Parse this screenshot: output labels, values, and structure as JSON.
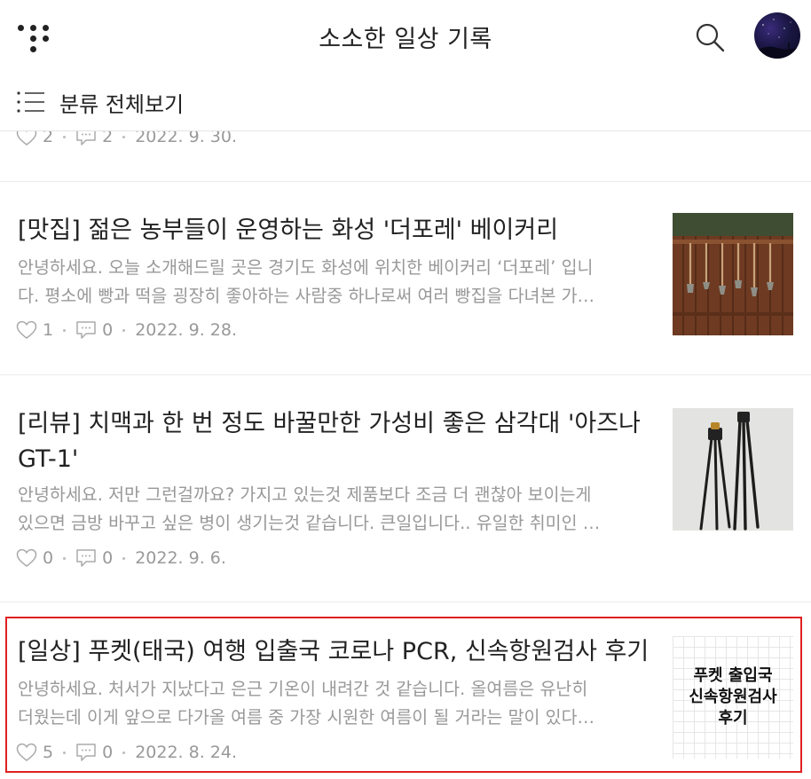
{
  "header": {
    "site_title": "소소한 일상 기록",
    "icons": [
      "menu-dots-icon",
      "search-icon",
      "avatar"
    ]
  },
  "category_bar": {
    "label": "분류 전체보기"
  },
  "partial_post": {
    "likes": "2",
    "comments": "2",
    "date": "2022. 9. 30."
  },
  "posts": [
    {
      "title": "[맛집] 젊은 농부들이 운영하는 화성 '더포레' 베이커리",
      "summary_line1": "안녕하세요. 오늘 소개해드릴 곳은 경기도 화성에 위치한 베이커리 ‘더포레’ 입니",
      "summary_line2": "다. 평소에 빵과 떡을 굉장히 좋아하는 사람중 하나로써 여러 빵집을 다녀본 가…",
      "likes": "1",
      "comments": "0",
      "date": "2022. 9. 28."
    },
    {
      "title": "[리뷰] 치맥과 한 번 정도 바꿀만한 가성비 좋은 삼각대 '아즈나 GT-1'",
      "summary_line1": "안녕하세요. 저만 그런걸까요? 가지고 있는것 제품보다 조금 더 괜찮아 보이는게",
      "summary_line2": "있으면 금방 바꾸고 싶은 병이 생기는것 같습니다. 큰일입니다.. 유일한 취미인 …",
      "likes": "0",
      "comments": "0",
      "date": "2022. 9. 6."
    },
    {
      "title": "[일상] 푸켓(태국) 여행 입출국 코로나 PCR, 신속항원검사 후기",
      "summary_line1": "안녕하세요. 처서가 지났다고 은근 기온이 내려간 것 같습니다. 올여름은 유난히",
      "summary_line2": "더웠는데 이게 앞으로 다가올 여름 중 가장 시원한 여름이 될 거라는 말이 있다…",
      "likes": "5",
      "comments": "0",
      "date": "2022. 8. 24.",
      "thumb_text": "푸켓 출입국\n신속항원검사\n후기"
    }
  ],
  "colors": {
    "text": "#222222",
    "muted": "#999999",
    "divider": "#ebebeb",
    "highlight": "#e02020"
  }
}
